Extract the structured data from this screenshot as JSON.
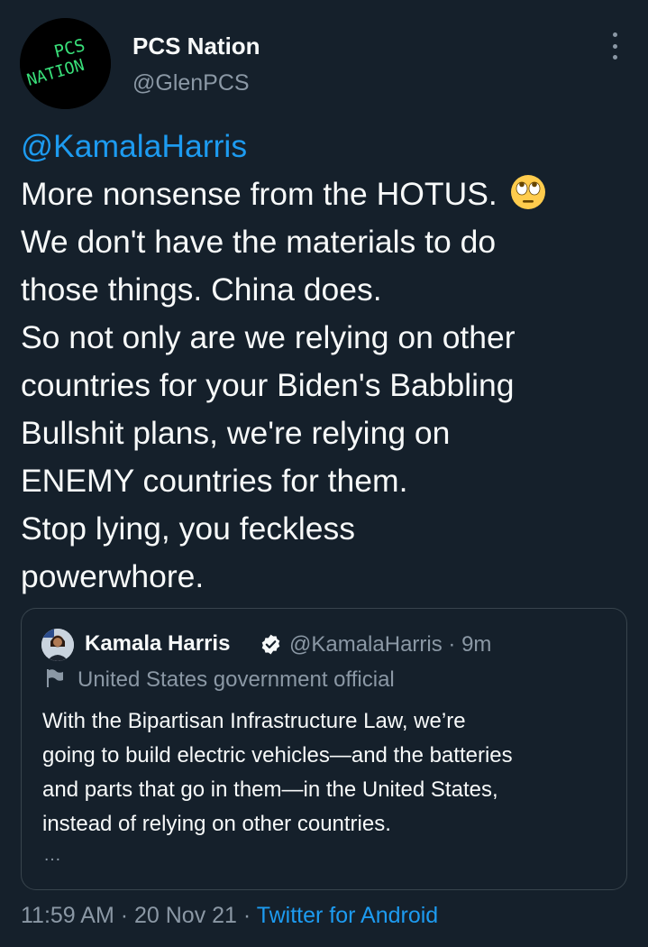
{
  "author": {
    "avatar_text": [
      "PCS",
      "NATION"
    ],
    "display_name": "PCS Nation",
    "handle": "@GlenPCS"
  },
  "tweet": {
    "mention": "@KamalaHarris",
    "lines": [
      "More nonsense from the HOTUS.",
      "We don't have the materials to do",
      "those things. China does.",
      "So not only are we relying on other",
      "countries for your Biden's Babbling",
      "Bullshit plans, we're relying on",
      "ENEMY countries for them.",
      "Stop lying, you feckless",
      "powerwhore."
    ],
    "emoji": "face-with-rolling-eyes"
  },
  "quoted": {
    "display_name": "Kamala Harris",
    "handle_time": "@KamalaHarris · 9m",
    "label": "United States government official",
    "lines": [
      "With the Bipartisan Infrastructure Law, we’re",
      "going to build electric vehicles—and the batteries",
      "and parts that go in them—in the United States,",
      "instead of relying on other countries."
    ],
    "ellipsis": "…"
  },
  "meta": {
    "time_date": "11:59 AM · 20 Nov 21 · ",
    "source": "Twitter for Android"
  },
  "colors": {
    "background": "#15202b",
    "text": "#f7f9f9",
    "secondary": "#8b98a5",
    "accent": "#1d9bf0",
    "border": "#38444d",
    "avatar_text": "#39e07a"
  }
}
